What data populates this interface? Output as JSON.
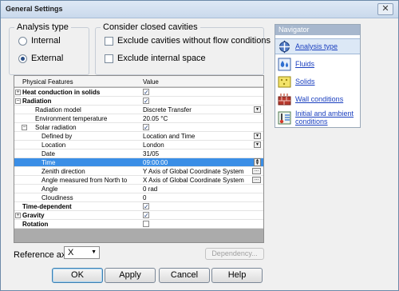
{
  "window": {
    "title": "General Settings",
    "close_glyph": "✕"
  },
  "analysis_type": {
    "legend": "Analysis type",
    "options": [
      {
        "label": "Internal",
        "selected": false
      },
      {
        "label": "External",
        "selected": true
      }
    ]
  },
  "closed_cavities": {
    "legend": "Consider closed cavities",
    "options": [
      {
        "label": "Exclude cavities without flow conditions",
        "checked": false
      },
      {
        "label": "Exclude internal space",
        "checked": false
      }
    ]
  },
  "navigator": {
    "title": "Navigator",
    "items": [
      {
        "label": "Analysis type",
        "icon": "analysis-type-icon"
      },
      {
        "label": "Fluids",
        "icon": "fluids-icon"
      },
      {
        "label": "Solids",
        "icon": "solids-icon"
      },
      {
        "label": "Wall conditions",
        "icon": "wall-conditions-icon"
      },
      {
        "label": "Initial and ambient conditions",
        "icon": "initial-conditions-icon"
      }
    ]
  },
  "grid": {
    "headers": [
      "Physical Features",
      "Value"
    ],
    "rows": [
      {
        "name": "Heat conduction in solids",
        "level": 0,
        "bold": true,
        "expander": "+",
        "value": "",
        "checkbox": true,
        "checked": true
      },
      {
        "name": "Radiation",
        "level": 0,
        "bold": true,
        "expander": "−",
        "value": "",
        "checkbox": true,
        "checked": true
      },
      {
        "name": "Radiation model",
        "level": 1,
        "value": "Discrete Transfer",
        "control": "dropdown"
      },
      {
        "name": "Environment temperature",
        "level": 1,
        "value": "20.05 °C"
      },
      {
        "name": "Solar radiation",
        "level": 1,
        "expander": "−",
        "value": "",
        "checkbox": true,
        "checked": true
      },
      {
        "name": "Defined by",
        "level": 2,
        "value": "Location and Time",
        "control": "dropdown"
      },
      {
        "name": "Location",
        "level": 2,
        "value": "London",
        "control": "dropdown"
      },
      {
        "name": "Date",
        "level": 2,
        "value": "31/05"
      },
      {
        "name": "Time",
        "level": 2,
        "value": "09:00:00",
        "control": "spinner",
        "selected": true
      },
      {
        "name": "Zenith direction",
        "level": 2,
        "value": "Y  Axis of Global Coordinate System",
        "control": "ellipsis"
      },
      {
        "name": "Angle measured from North to",
        "level": 2,
        "value": "X  Axis of Global Coordinate System",
        "control": "ellipsis"
      },
      {
        "name": "Angle",
        "level": 2,
        "value": "0 rad"
      },
      {
        "name": "Cloudiness",
        "level": 2,
        "value": "0"
      },
      {
        "name": "Time-dependent",
        "level": 0,
        "bold": true,
        "value": "",
        "checkbox": true,
        "checked": true
      },
      {
        "name": "Gravity",
        "level": 0,
        "bold": true,
        "expander": "+",
        "value": "",
        "checkbox": true,
        "checked": true
      },
      {
        "name": "Rotation",
        "level": 0,
        "bold": true,
        "value": "",
        "checkbox": true,
        "checked": false
      }
    ]
  },
  "reference_axis": {
    "label": "Reference axis:",
    "value": "X"
  },
  "buttons": {
    "dependency": "Dependency...",
    "ok": "OK",
    "apply": "Apply",
    "cancel": "Cancel",
    "help": "Help"
  }
}
